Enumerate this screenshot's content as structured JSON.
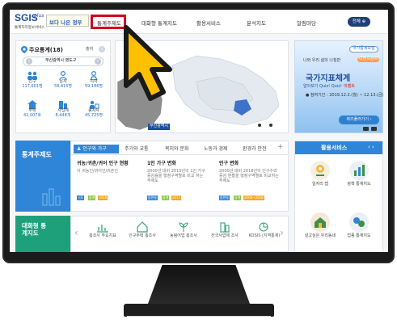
{
  "header": {
    "logo": "SGIS",
    "logo_plus": "plus",
    "logo_sub": "통계지리정보서비스",
    "badge": "보다 나은 정부",
    "nav": [
      "통계주제도",
      "대화형 통계지도",
      "활용서비스",
      "분석지도",
      "알림마당"
    ],
    "full_menu": "전체"
  },
  "stat_panel": {
    "title": "주요통계(18)",
    "more": "출처",
    "info": "i",
    "region": "부산광역시 영도구",
    "items": [
      {
        "label": "인구",
        "value": "117,601명",
        "icon": "population-icon"
      },
      {
        "label": "남자",
        "value": "58,415명",
        "icon": "male-icon"
      },
      {
        "label": "여자",
        "value": "59,186명",
        "icon": "female-icon"
      },
      {
        "label": "주택",
        "value": "42,007호",
        "icon": "house-icon"
      },
      {
        "label": "사업체",
        "value": "8,448개",
        "icon": "business-icon"
      },
      {
        "label": "종사자",
        "value": "45,725명",
        "icon": "worker-icon"
      }
    ]
  },
  "map": {
    "region_tag": "부산광역시"
  },
  "banner": {
    "tag": "국가통계포털",
    "line1": "나와 우리 삶의 나침반",
    "event_tag": "이벤트참여",
    "title": "국가지표체계",
    "event": "알아보기 Quiz! Quiz!",
    "event2": "이벤트",
    "period": "● 참여기간 : 2019.12.2.(월) ~ 12.13.(금)",
    "button": "퀴즈풀러가기 ›"
  },
  "theme_map": {
    "title": "통계주제도",
    "tabs": [
      "인구와 가구",
      "주거와 교통",
      "복지와 문화",
      "노동과 경제",
      "환경과 안전"
    ],
    "tab_plus": "+",
    "cards": [
      {
        "title": "귀농/귀촌/귀어 인구 현황",
        "desc": "이 귀농인/귀어인/귀촌인",
        "tags": [
          "시도",
          "합계",
          "2016"
        ]
      },
      {
        "title": "1인 가구 변화",
        "desc": "2000년 대비 2015년의 1인 가구 증감률을 행정구역별로 비교 하는 주제도",
        "tags": [
          "읍면동",
          "합계",
          "2015"
        ]
      },
      {
        "title": "인구 변화",
        "desc": "2000년 대비 2018년의 인구수와 증감 현황을 행정구역별로 비교하는 주제도",
        "tags": [
          "읍면동",
          "합계",
          "2000~2018"
        ]
      }
    ]
  },
  "services": {
    "title": "활용서비스",
    "nav": "‹ ›",
    "items": [
      {
        "label": "일자리 맵",
        "icon": "job-map-icon"
      },
      {
        "label": "정책 통계지도",
        "icon": "policy-map-icon"
      },
      {
        "label": "살고싶은 우리동네",
        "icon": "neighborhood-icon"
      },
      {
        "label": "업종 통계지도",
        "icon": "industry-map-icon"
      }
    ]
  },
  "interactive_map": {
    "title": "대화형 통계지도",
    "prev": "‹",
    "next": "›",
    "items": [
      {
        "label": "총조사 주요지표",
        "icon": "census-chart-icon"
      },
      {
        "label": "인구주택 총조사",
        "icon": "census-house-icon"
      },
      {
        "label": "농림어업 총조사",
        "icon": "agriculture-icon"
      },
      {
        "label": "전국사업체 조사",
        "icon": "business-survey-icon"
      },
      {
        "label": "KOSIS (지역통계)",
        "icon": "kosis-icon"
      }
    ]
  },
  "colors": {
    "highlight": "#d0021b",
    "cursor_fill": "#ffc000",
    "theme_blue": "#2f86d8",
    "interactive_green": "#1ea17a"
  }
}
